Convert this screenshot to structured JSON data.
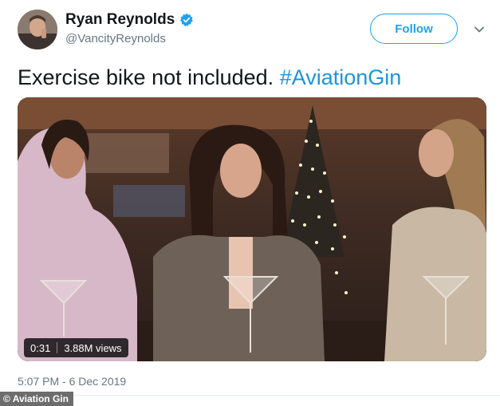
{
  "tweet": {
    "author_name": "Ryan Reynolds",
    "author_handle": "@VancityReynolds",
    "follow_label": "Follow",
    "text": "Exercise bike not included. ",
    "hashtag": "#AviationGin",
    "video_duration": "0:31",
    "video_views": "3.88M views",
    "timestamp": "5:07 PM - 6 Dec 2019"
  },
  "credit": "© Aviation Gin",
  "colors": {
    "accent": "#1da1f2",
    "hashtag": "#1b95e0",
    "text": "#14171a",
    "muted": "#657786"
  }
}
